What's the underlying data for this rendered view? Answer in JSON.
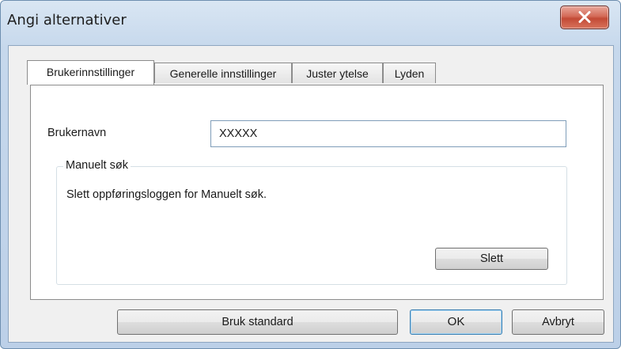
{
  "window": {
    "title": "Angi alternativer"
  },
  "tabs": [
    {
      "label": "Brukerinnstillinger",
      "active": true
    },
    {
      "label": "Generelle innstillinger",
      "active": false
    },
    {
      "label": "Juster ytelse",
      "active": false
    },
    {
      "label": "Lyden",
      "active": false
    }
  ],
  "user_settings": {
    "username_label": "Brukernavn",
    "username_value": "XXXXX",
    "manual_search": {
      "group_title": "Manuelt søk",
      "description": "Slett oppføringsloggen for Manuelt søk.",
      "delete_button": "Slett"
    }
  },
  "footer": {
    "default_button": "Bruk standard",
    "ok_button": "OK",
    "cancel_button": "Avbryt"
  },
  "colors": {
    "close_button": "#c24a36",
    "title_bar": "#c6d8ec",
    "dialog_background": "#f0f0f0",
    "panel_background": "#ffffff"
  },
  "icons": {
    "close": "close-icon"
  }
}
